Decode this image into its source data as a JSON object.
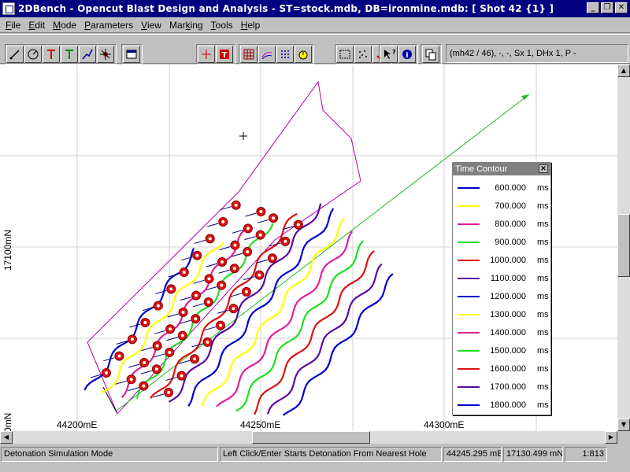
{
  "window": {
    "title": "2DBench - Opencut Blast Design and Analysis - ST=stock.mdb, DB=ironmine.mdb: [ Shot 42 {1} ]",
    "controls": [
      "minimize",
      "restore",
      "close"
    ]
  },
  "menu": {
    "items": [
      {
        "mnemonic": "F",
        "rest": "ile"
      },
      {
        "mnemonic": "E",
        "rest": "dit"
      },
      {
        "mnemonic": "M",
        "rest": "ode"
      },
      {
        "mnemonic": "P",
        "rest": "arameters"
      },
      {
        "mnemonic": "V",
        "rest": "iew"
      },
      {
        "mnemonic": "",
        "rest": "Mar",
        "after_mnemonic": "k",
        "tail": "ing"
      },
      {
        "mnemonic": "T",
        "rest": "ools"
      },
      {
        "mnemonic": "H",
        "rest": "elp"
      }
    ]
  },
  "toolbar": {
    "info_text": "(mh42 / 46), -, -, Sx 1, DHx 1, P -",
    "icons": [
      "line-draw-icon",
      "compass-icon",
      "hole-red-icon",
      "hole-green-icon",
      "polyline-icon",
      "burst-icon",
      "window-icon",
      "cursor-cross-icon",
      "text-tool-icon",
      "grid-icon",
      "contour-icon",
      "dots-grid-icon",
      "timer-icon",
      "select-region-icon",
      "scatter-icon",
      "anchor-icon",
      "help-pointer-icon",
      "info-icon",
      "copy-icon"
    ]
  },
  "map": {
    "x_labels": [
      "44200mE",
      "44250mE",
      "44300mE"
    ],
    "y_labels": [
      "17100mN",
      "0mN"
    ]
  },
  "legend": {
    "title": "Time Contour",
    "unit": "ms",
    "entries": [
      {
        "value": "600.000",
        "color": "#0000cc"
      },
      {
        "value": "700.000",
        "color": "#ffff00"
      },
      {
        "value": "800.000",
        "color": "#e0209a"
      },
      {
        "value": "900.000",
        "color": "#22dd22"
      },
      {
        "value": "1000.000",
        "color": "#dd1111"
      },
      {
        "value": "1100.000",
        "color": "#5a0aa0"
      },
      {
        "value": "1200.000",
        "color": "#0000cc"
      },
      {
        "value": "1300.000",
        "color": "#ffff00"
      },
      {
        "value": "1400.000",
        "color": "#e0209a"
      },
      {
        "value": "1500.000",
        "color": "#22dd22"
      },
      {
        "value": "1600.000",
        "color": "#dd1111"
      },
      {
        "value": "1700.000",
        "color": "#5a0aa0"
      },
      {
        "value": "1800.000",
        "color": "#0000cc"
      }
    ]
  },
  "status": {
    "mode": "Detonation Simulation Mode",
    "hint": "Left Click/Enter Starts Detonation From Nearest Hole",
    "easting": "44245.295 mE",
    "northing": "17130.499 mN",
    "scale": "1:813"
  }
}
